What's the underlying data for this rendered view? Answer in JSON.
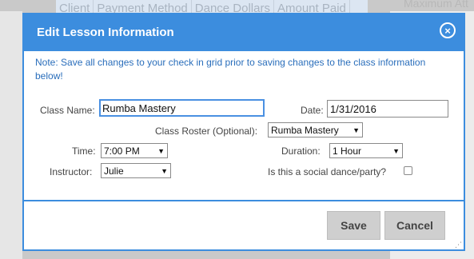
{
  "background": {
    "table_headers": [
      "Client",
      "Payment Method",
      "Dance Dollars",
      "Amount Paid"
    ],
    "right_label": "Maximum Att"
  },
  "modal": {
    "title": "Edit Lesson Information",
    "close_glyph": "×",
    "note": "Note: Save all changes to your check in grid prior to saving changes to the class information below!",
    "class_name": {
      "label": "Class Name:",
      "value": "Rumba Mastery"
    },
    "date": {
      "label": "Date:",
      "value": "1/31/2016"
    },
    "class_roster": {
      "label": "Class Roster (Optional):",
      "value": "Rumba Mastery"
    },
    "time": {
      "label": "Time:",
      "value": "7:00 PM"
    },
    "duration": {
      "label": "Duration:",
      "value": "1 Hour"
    },
    "instructor": {
      "label": "Instructor:",
      "value": "Julie"
    },
    "social": {
      "label": "Is this a social dance/party?",
      "checked": false
    },
    "save_label": "Save",
    "cancel_label": "Cancel",
    "dropdown_glyph": "▼"
  },
  "colors": {
    "accent": "#3c8dde",
    "note_text": "#2a6ebb",
    "button_bg": "#cfcfcf"
  }
}
